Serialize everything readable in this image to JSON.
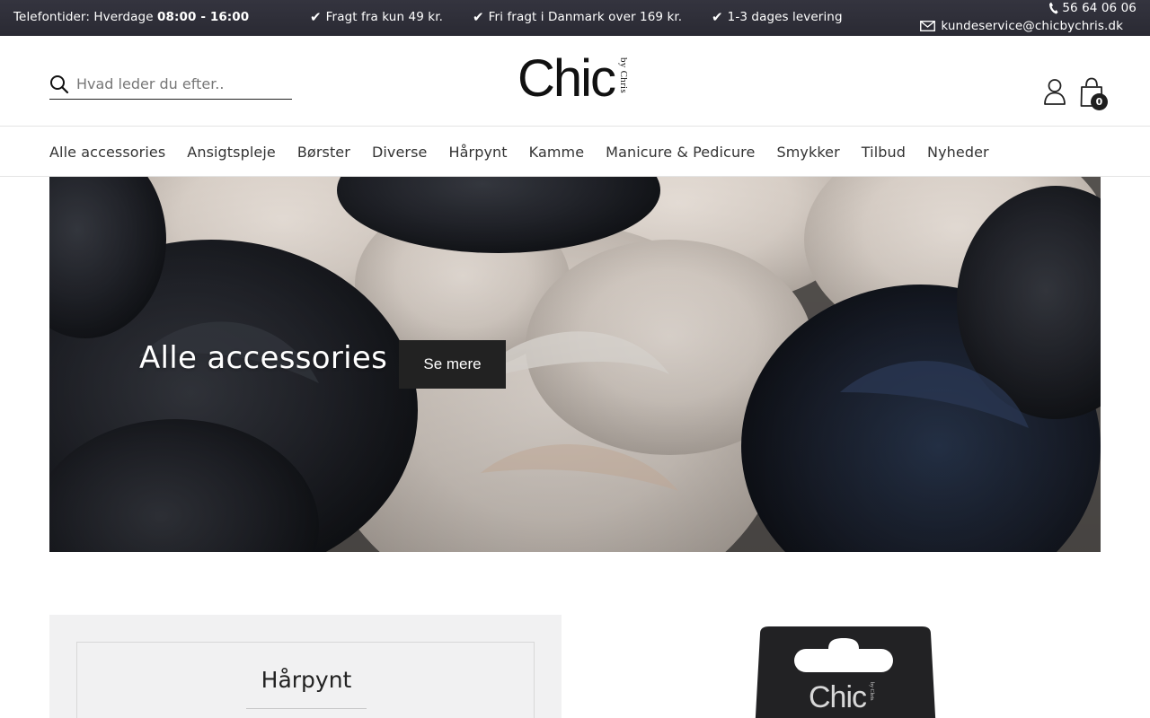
{
  "topbar": {
    "hours_label": "Telefontider: Hverdage",
    "hours_value": "08:00 - 16:00",
    "usps": [
      "Fragt fra kun 49 kr.",
      "Fri fragt i Danmark over 169 kr.",
      "1-3 dages levering"
    ],
    "phone": "56 64 06 06",
    "email": "kundeservice@chicbychris.dk"
  },
  "header": {
    "search_placeholder": "Hvad leder du efter..",
    "logo_main": "Chic",
    "logo_sub": "by Chris",
    "cart_count": "0"
  },
  "nav": {
    "items": [
      "Alle accessories",
      "Ansigtspleje",
      "Børster",
      "Diverse",
      "Hårpynt",
      "Kamme",
      "Manicure & Pedicure",
      "Smykker",
      "Tilbud",
      "Nyheder"
    ]
  },
  "hero": {
    "title": "Alle accessories",
    "button_label": "Se mere"
  },
  "category_card": {
    "title": "Hårpynt"
  },
  "product_card": {
    "brand_mark": "Chic",
    "brand_sub": "by Chris"
  },
  "colors": {
    "topbar_bg": "#2e2e37",
    "text": "#222222",
    "button_bg": "#222222",
    "card_bg": "#f1f1f2"
  }
}
